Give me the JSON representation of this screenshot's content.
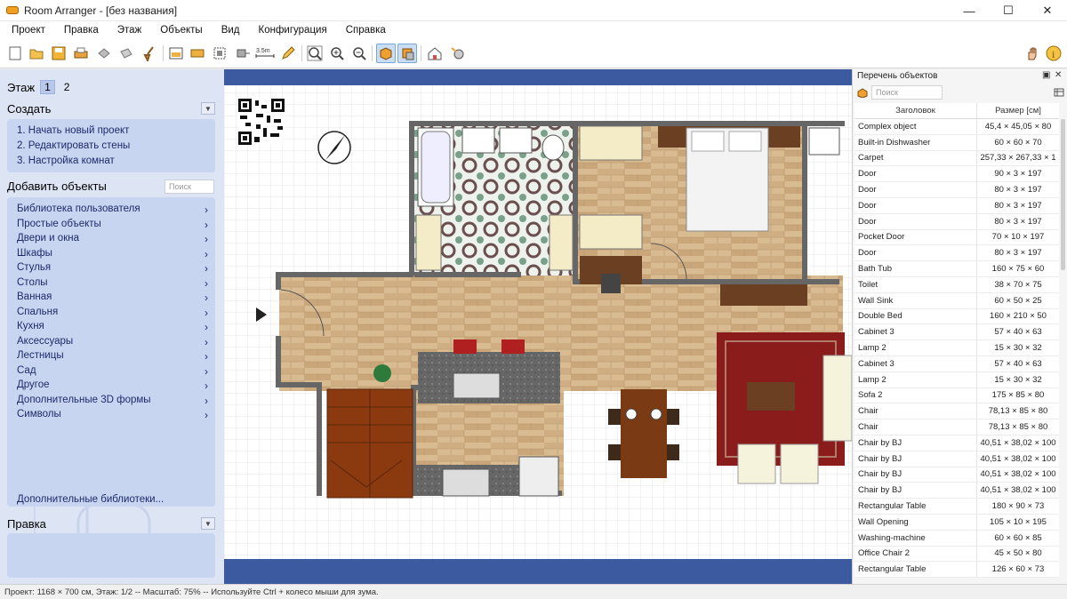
{
  "window": {
    "title": "Room Arranger - [без названия]"
  },
  "menu": [
    "Проект",
    "Правка",
    "Этаж",
    "Объекты",
    "Вид",
    "Конфигурация",
    "Справка"
  ],
  "left": {
    "floor_label": "Этаж",
    "floors": [
      "1",
      "2"
    ],
    "create": {
      "title": "Создать",
      "items": [
        "1. Начать новый проект",
        "2. Редактировать стены",
        "3. Настройка комнат"
      ]
    },
    "add_objects": {
      "title": "Добавить объекты",
      "search_placeholder": "Поиск",
      "categories": [
        "Библиотека пользователя",
        "Простые объекты",
        "Двери и окна",
        "Шкафы",
        "Стулья",
        "Столы",
        "Ванная",
        "Спальня",
        "Кухня",
        "Аксессуары",
        "Лестницы",
        "Сад",
        "Другое",
        "Дополнительные 3D формы",
        "Символы"
      ],
      "more_libraries": "Дополнительные библиотеки..."
    },
    "edit": {
      "title": "Правка"
    }
  },
  "right": {
    "title": "Перечень объектов",
    "search_placeholder": "Поиск",
    "columns": [
      "Заголовок",
      "Размер [см]"
    ],
    "rows": [
      [
        "Complex object",
        "45,4 × 45,05 × 80"
      ],
      [
        "Built-in Dishwasher",
        "60 × 60 × 70"
      ],
      [
        "Carpet",
        "257,33 × 267,33 × 1"
      ],
      [
        "Door",
        "90 × 3 × 197"
      ],
      [
        "Door",
        "80 × 3 × 197"
      ],
      [
        "Door",
        "80 × 3 × 197"
      ],
      [
        "Door",
        "80 × 3 × 197"
      ],
      [
        "Pocket Door",
        "70 × 10 × 197"
      ],
      [
        "Door",
        "80 × 3 × 197"
      ],
      [
        "Bath Tub",
        "160 × 75 × 60"
      ],
      [
        "Toilet",
        "38 × 70 × 75"
      ],
      [
        "Wall Sink",
        "60 × 50 × 25"
      ],
      [
        "Double Bed",
        "160 × 210 × 50"
      ],
      [
        "Cabinet 3",
        "57 × 40 × 63"
      ],
      [
        "Lamp 2",
        "15 × 30 × 32"
      ],
      [
        "Cabinet 3",
        "57 × 40 × 63"
      ],
      [
        "Lamp 2",
        "15 × 30 × 32"
      ],
      [
        "Sofa 2",
        "175 × 85 × 80"
      ],
      [
        "Chair",
        "78,13 × 85 × 80"
      ],
      [
        "Chair",
        "78,13 × 85 × 80"
      ],
      [
        "Chair by BJ",
        "40,51 × 38,02 × 100"
      ],
      [
        "Chair by BJ",
        "40,51 × 38,02 × 100"
      ],
      [
        "Chair by BJ",
        "40,51 × 38,02 × 100"
      ],
      [
        "Chair by BJ",
        "40,51 × 38,02 × 100"
      ],
      [
        "Rectangular Table",
        "180 × 90 × 73"
      ],
      [
        "Wall Opening",
        "105 × 10 × 195"
      ],
      [
        "Washing-machine",
        "60 × 60 × 85"
      ],
      [
        "Office Chair 2",
        "45 × 50 × 80"
      ],
      [
        "Rectangular Table",
        "126 × 60 × 73"
      ]
    ]
  },
  "toolbar": {
    "icons": [
      "new-icon",
      "open-icon",
      "save-icon",
      "print-icon",
      "undo-icon",
      "redo-icon",
      "broom-icon",
      "wall-icon",
      "window-icon",
      "object-icon",
      "move-icon",
      "measure-icon",
      "pencil-icon",
      "zoom-fit-icon",
      "zoom-in-icon",
      "zoom-out-icon",
      "view-2d-icon",
      "view-3d-icon",
      "house-3d-icon",
      "settings-3d-icon",
      "hand-icon",
      "info-icon"
    ],
    "measure_label": "3.5m"
  },
  "status": {
    "text": "Проект: 1168 × 700 см, Этаж: 1/2 -- Масштаб: 75% -- Используйте Ctrl + колесо мыши для зума."
  },
  "colors": {
    "accent": "#3c5aa0",
    "panel": "#c8d5f0",
    "floor_wood": "#d8b98f",
    "carpet": "#8b1c1c",
    "stairs": "#8b3a10"
  }
}
